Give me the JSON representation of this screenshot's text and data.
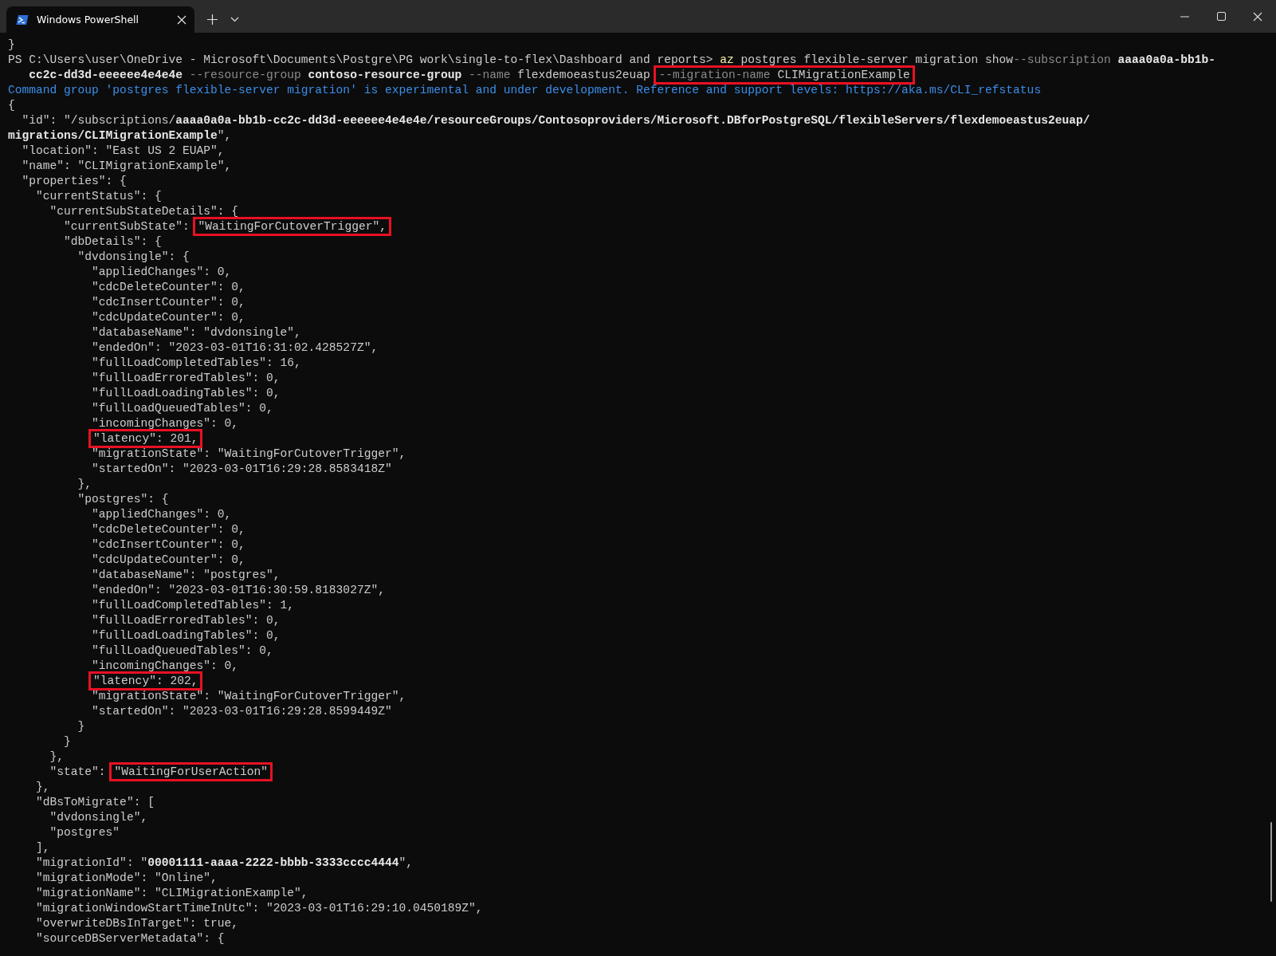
{
  "window": {
    "tab_title": "Windows PowerShell"
  },
  "lines": [
    {
      "segments": [
        {
          "kind": "plain",
          "text": "}"
        }
      ]
    },
    {
      "segments": [
        {
          "kind": "plain",
          "text": "PS C:\\Users\\user\\OneDrive - Microsoft\\Documents\\Postgre\\PG work\\single-to-flex\\Dashboard and reports> "
        },
        {
          "kind": "command",
          "text": "az"
        },
        {
          "kind": "plain",
          "text": " postgres flexible-server migration show"
        },
        {
          "kind": "flag",
          "text": "--subscription"
        },
        {
          "kind": "bold",
          "text": " aaaa0a0a-bb1b-"
        }
      ]
    },
    {
      "segments": [
        {
          "kind": "bold",
          "text": "   cc2c-dd3d-eeeeee4e4e4e"
        },
        {
          "kind": "flag",
          "text": " --resource-group "
        },
        {
          "kind": "bold",
          "text": "contoso-resource-group"
        },
        {
          "kind": "flag",
          "text": " --name "
        },
        {
          "kind": "plain",
          "text": "flexdemoeastus2euap "
        },
        {
          "kind": "box",
          "parts": [
            {
              "kind": "flag",
              "text": "--migration-name "
            },
            {
              "kind": "plain",
              "text": "CLIMigrationExample"
            }
          ]
        }
      ]
    },
    {
      "segments": [
        {
          "kind": "info",
          "text": "Command group 'postgres flexible-server migration' is experimental and under development. Reference and support levels: https://aka.ms/CLI_refstatus"
        }
      ]
    },
    {
      "segments": [
        {
          "kind": "plain",
          "text": "{"
        }
      ]
    },
    {
      "segments": [
        {
          "kind": "plain",
          "text": "  \"id\": \"/subscriptions/"
        },
        {
          "kind": "bold",
          "text": "aaaa0a0a-bb1b-cc2c-dd3d-eeeeee4e4e4e/resourceGroups/Contosoproviders/Microsoft.DBforPostgreSQL/flexibleServers/flexdemoeastus2euap/"
        }
      ]
    },
    {
      "segments": [
        {
          "kind": "bold",
          "text": "migrations/CLIMigrationExample"
        },
        {
          "kind": "plain",
          "text": "\","
        }
      ]
    },
    {
      "segments": [
        {
          "kind": "plain",
          "text": "  \"location\": \"East US 2 EUAP\","
        }
      ]
    },
    {
      "segments": [
        {
          "kind": "plain",
          "text": "  \"name\": \"CLIMigrationExample\","
        }
      ]
    },
    {
      "segments": [
        {
          "kind": "plain",
          "text": "  \"properties\": {"
        }
      ]
    },
    {
      "segments": [
        {
          "kind": "plain",
          "text": "    \"currentStatus\": {"
        }
      ]
    },
    {
      "segments": [
        {
          "kind": "plain",
          "text": "      \"currentSubStateDetails\": {"
        }
      ]
    },
    {
      "segments": [
        {
          "kind": "plain",
          "text": "        \"currentSubState\": "
        },
        {
          "kind": "box",
          "parts": [
            {
              "kind": "plain",
              "text": "\"WaitingForCutoverTrigger\","
            }
          ]
        }
      ]
    },
    {
      "segments": [
        {
          "kind": "plain",
          "text": "        \"dbDetails\": {"
        }
      ]
    },
    {
      "segments": [
        {
          "kind": "plain",
          "text": "          \"dvdonsingle\": {"
        }
      ]
    },
    {
      "segments": [
        {
          "kind": "plain",
          "text": "            \"appliedChanges\": 0,"
        }
      ]
    },
    {
      "segments": [
        {
          "kind": "plain",
          "text": "            \"cdcDeleteCounter\": 0,"
        }
      ]
    },
    {
      "segments": [
        {
          "kind": "plain",
          "text": "            \"cdcInsertCounter\": 0,"
        }
      ]
    },
    {
      "segments": [
        {
          "kind": "plain",
          "text": "            \"cdcUpdateCounter\": 0,"
        }
      ]
    },
    {
      "segments": [
        {
          "kind": "plain",
          "text": "            \"databaseName\": \"dvdonsingle\","
        }
      ]
    },
    {
      "segments": [
        {
          "kind": "plain",
          "text": "            \"endedOn\": \"2023-03-01T16:31:02.428527Z\","
        }
      ]
    },
    {
      "segments": [
        {
          "kind": "plain",
          "text": "            \"fullLoadCompletedTables\": 16,"
        }
      ]
    },
    {
      "segments": [
        {
          "kind": "plain",
          "text": "            \"fullLoadErroredTables\": 0,"
        }
      ]
    },
    {
      "segments": [
        {
          "kind": "plain",
          "text": "            \"fullLoadLoadingTables\": 0,"
        }
      ]
    },
    {
      "segments": [
        {
          "kind": "plain",
          "text": "            \"fullLoadQueuedTables\": 0,"
        }
      ]
    },
    {
      "segments": [
        {
          "kind": "plain",
          "text": "            \"incomingChanges\": 0,"
        }
      ]
    },
    {
      "indented": true,
      "segments": [
        {
          "kind": "box",
          "parts": [
            {
              "kind": "plain",
              "text": "\"latency\": 201,"
            }
          ]
        }
      ]
    },
    {
      "segments": [
        {
          "kind": "plain",
          "text": "            \"migrationState\": \"WaitingForCutoverTrigger\","
        }
      ]
    },
    {
      "segments": [
        {
          "kind": "plain",
          "text": "            \"startedOn\": \"2023-03-01T16:29:28.8583418Z\""
        }
      ]
    },
    {
      "segments": [
        {
          "kind": "plain",
          "text": "          },"
        }
      ]
    },
    {
      "segments": [
        {
          "kind": "plain",
          "text": "          \"postgres\": {"
        }
      ]
    },
    {
      "segments": [
        {
          "kind": "plain",
          "text": "            \"appliedChanges\": 0,"
        }
      ]
    },
    {
      "segments": [
        {
          "kind": "plain",
          "text": "            \"cdcDeleteCounter\": 0,"
        }
      ]
    },
    {
      "segments": [
        {
          "kind": "plain",
          "text": "            \"cdcInsertCounter\": 0,"
        }
      ]
    },
    {
      "segments": [
        {
          "kind": "plain",
          "text": "            \"cdcUpdateCounter\": 0,"
        }
      ]
    },
    {
      "segments": [
        {
          "kind": "plain",
          "text": "            \"databaseName\": \"postgres\","
        }
      ]
    },
    {
      "segments": [
        {
          "kind": "plain",
          "text": "            \"endedOn\": \"2023-03-01T16:30:59.8183027Z\","
        }
      ]
    },
    {
      "segments": [
        {
          "kind": "plain",
          "text": "            \"fullLoadCompletedTables\": 1,"
        }
      ]
    },
    {
      "segments": [
        {
          "kind": "plain",
          "text": "            \"fullLoadErroredTables\": 0,"
        }
      ]
    },
    {
      "segments": [
        {
          "kind": "plain",
          "text": "            \"fullLoadLoadingTables\": 0,"
        }
      ]
    },
    {
      "segments": [
        {
          "kind": "plain",
          "text": "            \"fullLoadQueuedTables\": 0,"
        }
      ]
    },
    {
      "segments": [
        {
          "kind": "plain",
          "text": "            \"incomingChanges\": 0,"
        }
      ]
    },
    {
      "indented": true,
      "segments": [
        {
          "kind": "box",
          "parts": [
            {
              "kind": "plain",
              "text": "\"latency\": 202,"
            }
          ]
        }
      ]
    },
    {
      "segments": [
        {
          "kind": "plain",
          "text": "            \"migrationState\": \"WaitingForCutoverTrigger\","
        }
      ]
    },
    {
      "segments": [
        {
          "kind": "plain",
          "text": "            \"startedOn\": \"2023-03-01T16:29:28.8599449Z\""
        }
      ]
    },
    {
      "segments": [
        {
          "kind": "plain",
          "text": "          }"
        }
      ]
    },
    {
      "segments": [
        {
          "kind": "plain",
          "text": "        }"
        }
      ]
    },
    {
      "segments": [
        {
          "kind": "plain",
          "text": "      },"
        }
      ]
    },
    {
      "segments": [
        {
          "kind": "plain",
          "text": "      \"state\": "
        },
        {
          "kind": "box",
          "parts": [
            {
              "kind": "plain",
              "text": "\"WaitingForUserAction\""
            }
          ]
        }
      ]
    },
    {
      "segments": [
        {
          "kind": "plain",
          "text": "    },"
        }
      ]
    },
    {
      "segments": [
        {
          "kind": "plain",
          "text": "    \"dBsToMigrate\": ["
        }
      ]
    },
    {
      "segments": [
        {
          "kind": "plain",
          "text": "      \"dvdonsingle\","
        }
      ]
    },
    {
      "segments": [
        {
          "kind": "plain",
          "text": "      \"postgres\""
        }
      ]
    },
    {
      "segments": [
        {
          "kind": "plain",
          "text": "    ],"
        }
      ]
    },
    {
      "segments": [
        {
          "kind": "plain",
          "text": "    \"migrationId\": \""
        },
        {
          "kind": "bold",
          "text": "00001111-aaaa-2222-bbbb-3333cccc4444"
        },
        {
          "kind": "plain",
          "text": "\","
        }
      ]
    },
    {
      "segments": [
        {
          "kind": "plain",
          "text": "    \"migrationMode\": \"Online\","
        }
      ]
    },
    {
      "segments": [
        {
          "kind": "plain",
          "text": "    \"migrationName\": \"CLIMigrationExample\","
        }
      ]
    },
    {
      "segments": [
        {
          "kind": "plain",
          "text": "    \"migrationWindowStartTimeInUtc\": \"2023-03-01T16:29:10.0450189Z\","
        }
      ]
    },
    {
      "segments": [
        {
          "kind": "plain",
          "text": "    \"overwriteDBsInTarget\": true,"
        }
      ]
    },
    {
      "segments": [
        {
          "kind": "plain",
          "text": "    \"sourceDBServerMetadata\": {"
        }
      ]
    }
  ]
}
